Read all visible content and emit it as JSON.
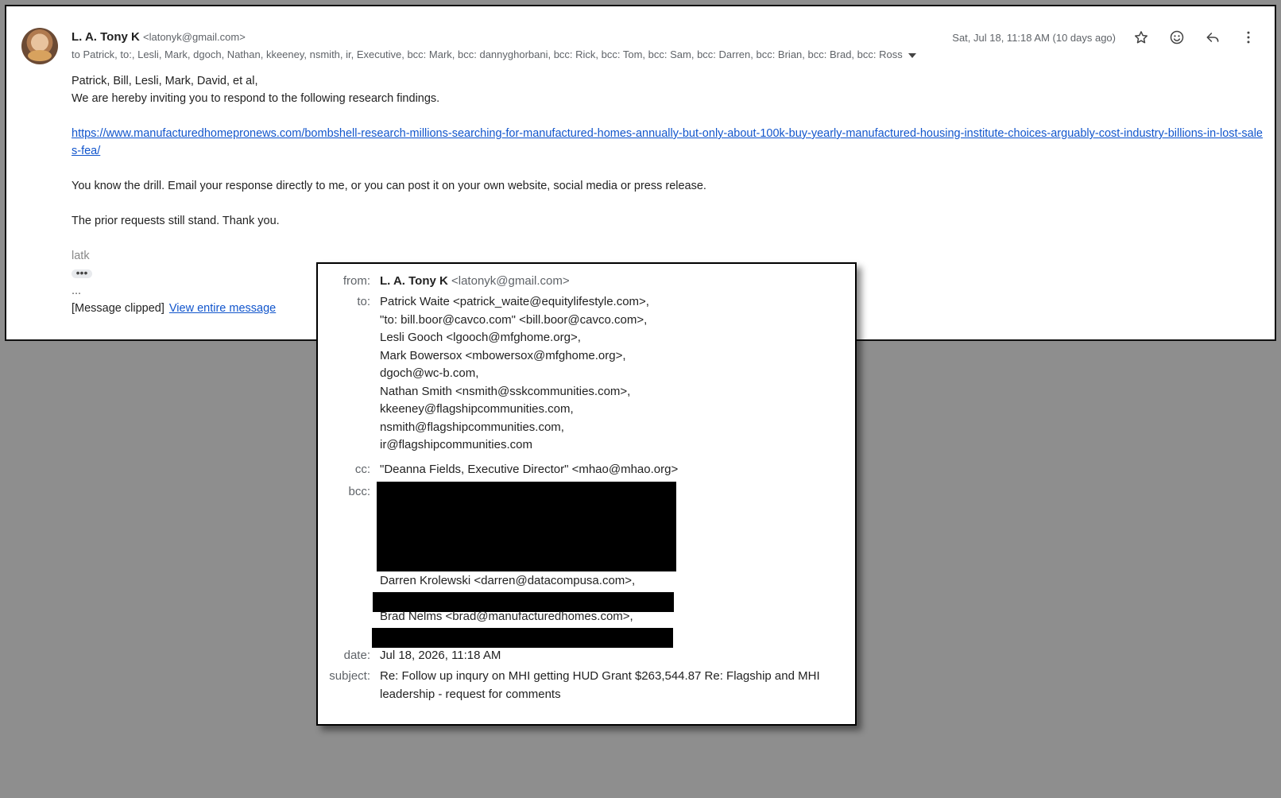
{
  "email": {
    "sender_name": "L. A. Tony K",
    "sender_email": "<latonyk@gmail.com>",
    "recipients_summary": "to Patrick, to:, Lesli, Mark, dgoch, Nathan, kkeeney, nsmith, ir, Executive, bcc: Mark, bcc: dannyghorbani, bcc: Rick, bcc: Tom, bcc: Sam, bcc: Darren, bcc: Brian, bcc: Brad, bcc: Ross",
    "timestamp": "Sat, Jul 18, 11:18 AM (10 days ago)",
    "greeting": "Patrick, Bill, Lesli, Mark, David, et al,",
    "line1": "We are hereby inviting you to respond to the following research findings.",
    "link": "https://www.manufacturedhomepronews.com/bombshell-research-millions-searching-for-manufactured-homes-annually-but-only-about-100k-buy-yearly-manufactured-housing-institute-choices-arguably-cost-industry-billions-in-lost-sales-fea/",
    "line2": "You know the drill. Email your response directly to me, or you can post it on your own website, social media or press release.",
    "line3": "The prior requests still stand. Thank you.",
    "signature": "latk",
    "dots": "•••",
    "ellipsis": "...",
    "clipped_text": "[Message clipped]",
    "view_entire": "View entire message"
  },
  "actions": [
    {
      "name": "star-icon"
    },
    {
      "name": "emoji-icon"
    },
    {
      "name": "reply-icon"
    },
    {
      "name": "more-vert-icon"
    }
  ],
  "details": {
    "from_label": "from:",
    "from_name": "L. A. Tony K",
    "from_email": "<latonyk@gmail.com>",
    "to_label": "to:",
    "to": [
      "Patrick Waite <patrick_waite@equitylifestyle.com>,",
      "\"to: bill.boor@cavco.com\" <bill.boor@cavco.com>,",
      "Lesli Gooch <lgooch@mfghome.org>,",
      "Mark Bowersox <mbowersox@mfghome.org>,",
      "dgoch@wc-b.com,",
      "Nathan Smith <nsmith@sskcommunities.com>,",
      "kkeeney@flagshipcommunities.com,",
      "nsmith@flagshipcommunities.com,",
      "ir@flagshipcommunities.com"
    ],
    "cc_label": "cc:",
    "cc": "\"Deanna Fields, Executive Director\" <mhao@mhao.org>",
    "bcc_label": "bcc:",
    "bcc_visible_1": "Darren Krolewski <darren@datacompusa.com>,",
    "bcc_visible_2": "Brad Nelms <brad@manufacturedhomes.com>,",
    "date_label": "date:",
    "date": "Jul 18, 2026, 11:18 AM",
    "subject_label": "subject:",
    "subject_line1": "Re: Follow up inqury on MHI getting HUD Grant $263,544.87 Re: Flagship and MHI",
    "subject_line2": "leadership - request for comments"
  }
}
